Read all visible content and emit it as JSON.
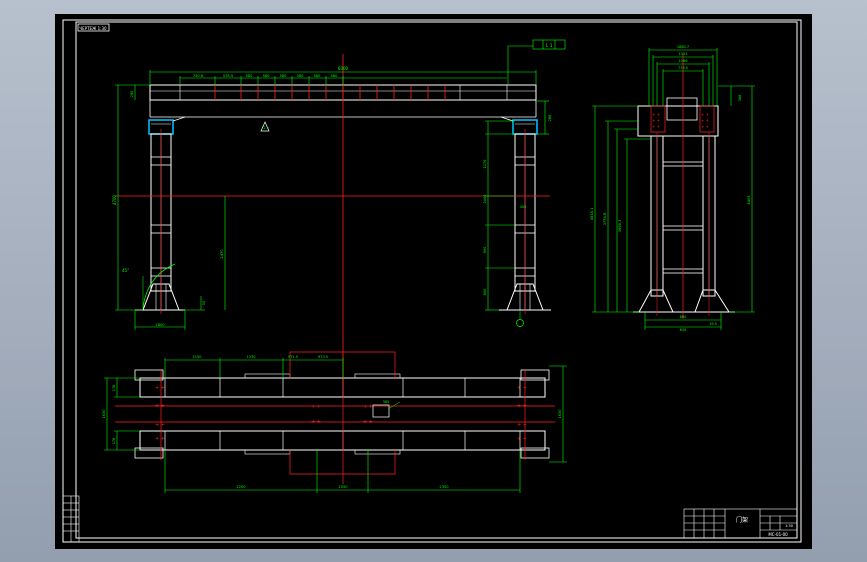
{
  "drawing": {
    "sheet_tag": "ЧЕРТЕЖ 1:30",
    "colors": {
      "background": "#000000",
      "outline": "#ffffff",
      "dimension": "#00ff00",
      "centerline": "#ff2020",
      "highlight": "#00c8ff",
      "frame": "#ffffff"
    },
    "front_view": {
      "overall_span": "6000",
      "left_height": "4700",
      "beam_height": "290",
      "column_gap": "2400",
      "top_dims": [
        "750.6",
        "578.5",
        "580",
        "580",
        "580",
        "580",
        "580",
        "580"
      ],
      "right_dims": [
        "288",
        "1176",
        "2400",
        "400",
        "900",
        "800"
      ],
      "leg_base": "1800",
      "leg_mid": "2470",
      "leg_small": "50",
      "angle_note": "45°",
      "top_flag": "1 1",
      "center_mark": "12.5"
    },
    "side_view": {
      "top_dims": [
        "1880.7",
        "1351",
        "1166",
        "776.5"
      ],
      "height_main": "4700",
      "heights_left": [
        "4514.1",
        "3774.8",
        "3698.3"
      ],
      "right_dim": "4405",
      "right_top": "388",
      "base_dims": [
        "800",
        "630"
      ],
      "base_small": "19.5"
    },
    "plan_view": {
      "top_dims": [
        "1150",
        "1330",
        "971.5",
        "973.5"
      ],
      "left_dims": [
        "178",
        "1630",
        "178"
      ],
      "right_dim": "1630",
      "bottom_dims": [
        "2200",
        "2550",
        "2350"
      ],
      "center_tag": "385"
    },
    "title_block": {
      "name": "门架",
      "drawing_no": "MC-01-00",
      "scale": "1:30"
    }
  }
}
